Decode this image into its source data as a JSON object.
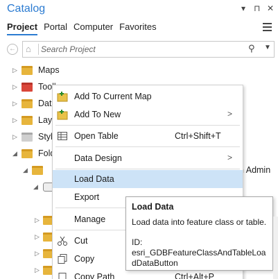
{
  "pane": {
    "title": "Catalog",
    "controls": {
      "dropdown": "▾",
      "pin": "⊓",
      "close": "✕"
    },
    "tabs": [
      {
        "label": "Project",
        "active": true
      },
      {
        "label": "Portal",
        "active": false
      },
      {
        "label": "Computer",
        "active": false
      },
      {
        "label": "Favorites",
        "active": false
      }
    ]
  },
  "search": {
    "placeholder": "Search Project"
  },
  "tree": [
    {
      "label": "Maps"
    },
    {
      "label": "Tooll"
    },
    {
      "label": "Dat"
    },
    {
      "label": "Lay"
    },
    {
      "label": "Styl"
    },
    {
      "label": "Fold"
    },
    {
      "label": "n Admin"
    }
  ],
  "context_menu": {
    "items": [
      {
        "label": "Add To Current Map",
        "icon": "add-to-map-icon"
      },
      {
        "label": "Add To New",
        "icon": "add-to-new-icon",
        "submenu": true
      },
      {
        "label": "Open Table",
        "shortcut": "Ctrl+Shift+T",
        "icon": "table-icon"
      },
      {
        "label": "Data Design",
        "submenu": true
      },
      {
        "label": "Load Data",
        "highlighted": true
      },
      {
        "label": "Export",
        "submenu": true
      },
      {
        "label": "Manage"
      },
      {
        "label": "Cut",
        "icon": "scissors-icon"
      },
      {
        "label": "Copy",
        "icon": "copy-icon"
      },
      {
        "label": "Copy Path",
        "shortcut": "Ctrl+Alt+P",
        "icon": "copy-path-icon"
      }
    ]
  },
  "tooltip": {
    "title": "Load Data",
    "description": "Load data into feature class or table.",
    "id_label": "ID:",
    "id_value": "esri_GDBFeatureClassAndTableLoadDataButton"
  },
  "colors": {
    "accent": "#2b7bd1",
    "highlight": "#cde3f7",
    "folder": "#e7b53c"
  }
}
